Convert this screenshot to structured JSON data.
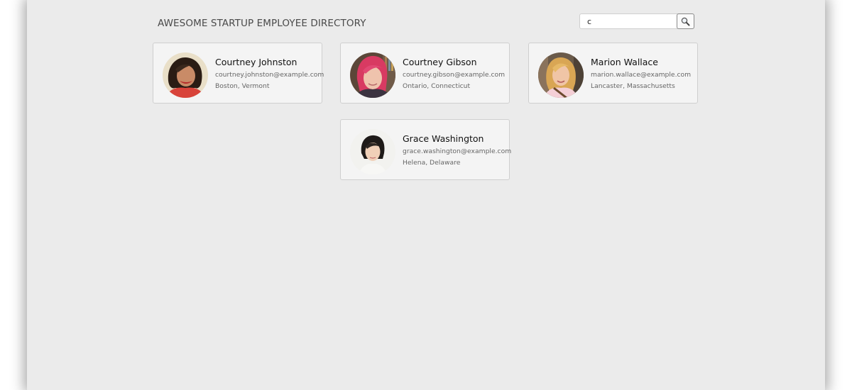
{
  "header": {
    "title": "AWESOME STARTUP EMPLOYEE DIRECTORY"
  },
  "search": {
    "value": "c"
  },
  "employees": [
    {
      "name": "Courtney Johnston",
      "email": "courtney.johnston@example.com",
      "location": "Boston, Vermont"
    },
    {
      "name": "Courtney Gibson",
      "email": "courtney.gibson@example.com",
      "location": "Ontario, Connecticut"
    },
    {
      "name": "Marion Wallace",
      "email": "marion.wallace@example.com",
      "location": "Lancaster, Massachusetts"
    },
    {
      "name": "Grace Washington",
      "email": "grace.washington@example.com",
      "location": "Helena, Delaware"
    }
  ],
  "icons": {
    "search_button": "magnifier-icon"
  },
  "colors": {
    "page_background": "#ebebeb",
    "card_background": "#f4f4f4",
    "card_border": "#cfcfcf"
  }
}
